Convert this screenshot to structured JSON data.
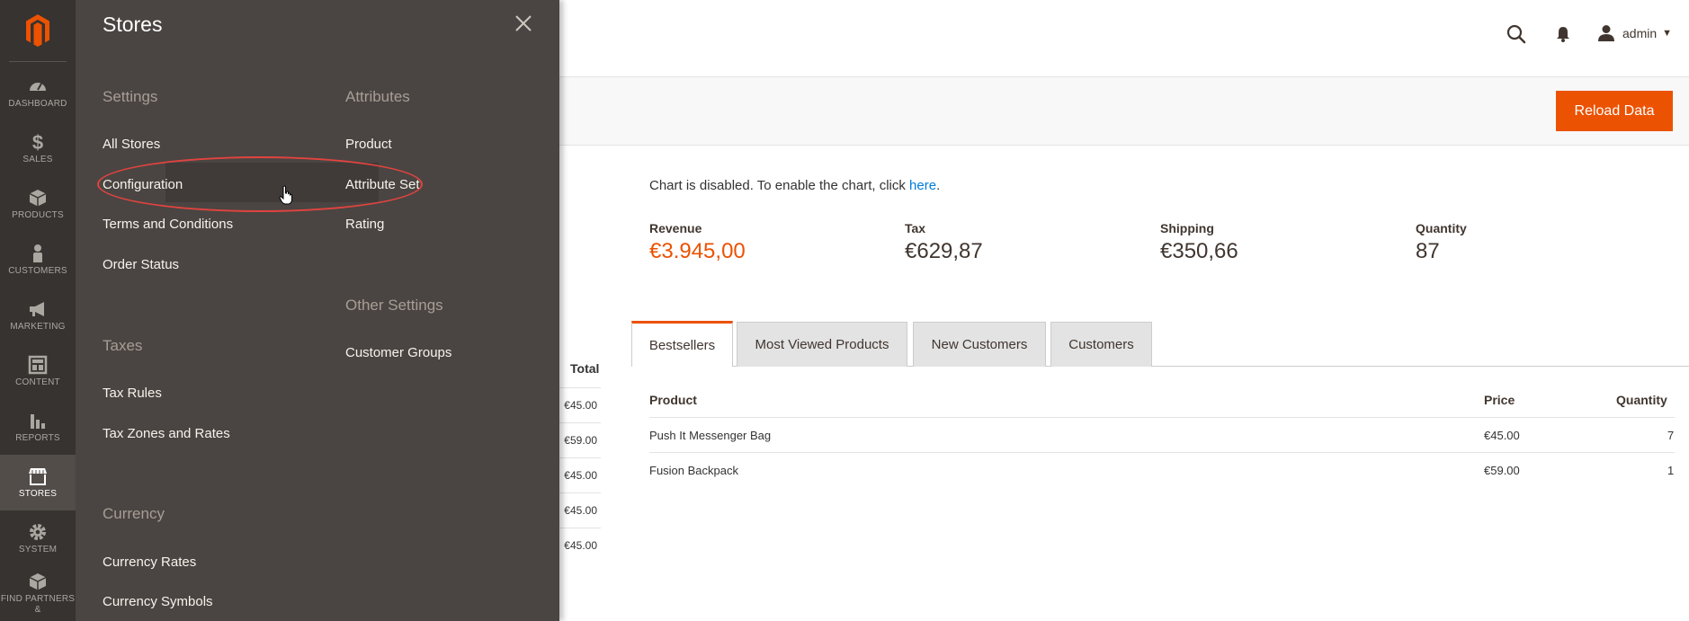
{
  "nav": {
    "items": [
      {
        "label": "DASHBOARD",
        "icon": "speedometer-icon"
      },
      {
        "label": "SALES",
        "icon": "dollar-icon"
      },
      {
        "label": "PRODUCTS",
        "icon": "cube-icon"
      },
      {
        "label": "CUSTOMERS",
        "icon": "person-icon"
      },
      {
        "label": "MARKETING",
        "icon": "megaphone-icon"
      },
      {
        "label": "CONTENT",
        "icon": "layout-icon"
      },
      {
        "label": "REPORTS",
        "icon": "bar-chart-icon"
      },
      {
        "label": "STORES",
        "icon": "storefront-icon"
      },
      {
        "label": "SYSTEM",
        "icon": "gear-icon"
      },
      {
        "label": "FIND PARTNERS &",
        "icon": "partners-box-icon"
      }
    ]
  },
  "flyout": {
    "title": "Stores",
    "settings": {
      "heading": "Settings",
      "links": [
        "All Stores",
        "Configuration",
        "Terms and Conditions",
        "Order Status"
      ]
    },
    "taxes": {
      "heading": "Taxes",
      "links": [
        "Tax Rules",
        "Tax Zones and Rates"
      ]
    },
    "currency": {
      "heading": "Currency",
      "links": [
        "Currency Rates",
        "Currency Symbols"
      ]
    },
    "attributes": {
      "heading": "Attributes",
      "links": [
        "Product",
        "Attribute Set",
        "Rating"
      ]
    },
    "other": {
      "heading": "Other Settings",
      "links": [
        "Customer Groups"
      ]
    }
  },
  "header": {
    "user": "admin"
  },
  "actions": {
    "reload": "Reload Data"
  },
  "dashboard": {
    "chart_msg": "Chart is disabled. To enable the chart, click ",
    "chart_link": "here",
    "chart_msg_end": ".",
    "stats": [
      {
        "label": "Revenue",
        "value": "€3.945,00"
      },
      {
        "label": "Tax",
        "value": "€629,87"
      },
      {
        "label": "Shipping",
        "value": "€350,66"
      },
      {
        "label": "Quantity",
        "value": "87"
      }
    ],
    "left_table": {
      "header": "Total",
      "values": [
        "€45.00",
        "€59.00",
        "€45.00",
        "€45.00",
        "€45.00"
      ]
    },
    "tabs": [
      "Bestsellers",
      "Most Viewed Products",
      "New Customers",
      "Customers"
    ],
    "table": {
      "columns": [
        "Product",
        "Price",
        "Quantity"
      ],
      "rows": [
        {
          "product": "Push It Messenger Bag",
          "price": "€45.00",
          "qty": "7"
        },
        {
          "product": "Fusion Backpack",
          "price": "€59.00",
          "qty": "1"
        }
      ]
    }
  },
  "colors": {
    "accent": "#eb5202",
    "nav_bg": "#373330",
    "flyout_bg": "#4a4542",
    "annotation": "#e2433f"
  }
}
